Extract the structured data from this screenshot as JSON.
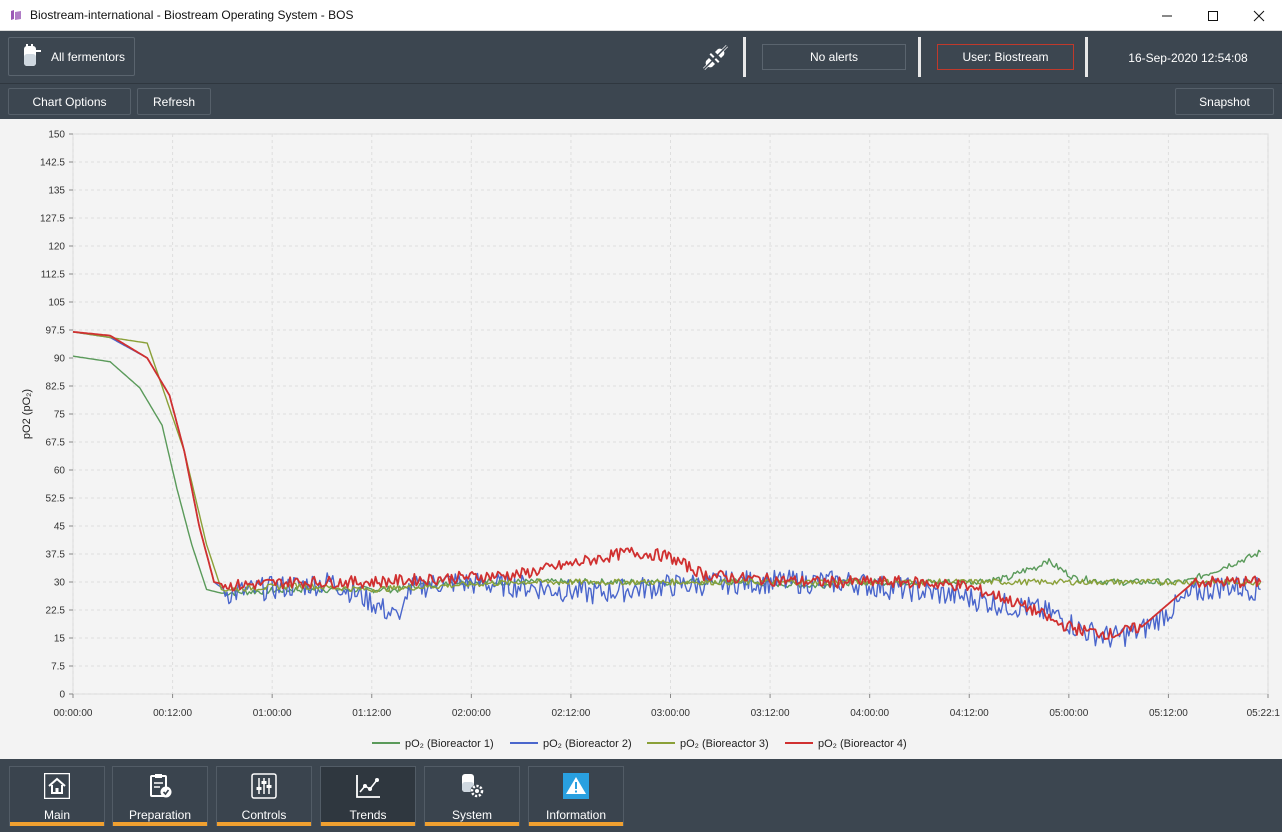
{
  "window": {
    "title": "Biostream-international - Biostream Operating System - BOS"
  },
  "header": {
    "fermentors_label": "All fermentors",
    "alerts_label": "No alerts",
    "user_label": "User: Biostream",
    "datetime": "16-Sep-2020 12:54:08"
  },
  "toolbar": {
    "chart_options_label": "Chart Options",
    "refresh_label": "Refresh",
    "snapshot_label": "Snapshot"
  },
  "chart_data": {
    "type": "line",
    "ylabel": "pO2 (pO₂)",
    "ylim": [
      0,
      150
    ],
    "ytick_step": 7.5,
    "y_ticks": [
      "0",
      "7.5",
      "15",
      "22.5",
      "30",
      "37.5",
      "45",
      "52.5",
      "60",
      "67.5",
      "75",
      "82.5",
      "90",
      "97.5",
      "105",
      "112.5",
      "120",
      "127.5",
      "135",
      "142.5",
      "150"
    ],
    "xlim_minutes": [
      0,
      322
    ],
    "x_ticks": [
      "00:00:00",
      "00:12:00",
      "01:00:00",
      "01:12:00",
      "02:00:00",
      "02:12:00",
      "03:00:00",
      "03:12:00",
      "04:00:00",
      "04:12:00",
      "05:00:00",
      "05:12:00",
      "05:22:1"
    ],
    "grid": true,
    "legend_position": "bottom",
    "series": [
      {
        "name": "pO₂ (Bioreactor 1)",
        "color": "#5a9a5a",
        "x": [
          0,
          10,
          18,
          24,
          28,
          32,
          36,
          40,
          60,
          80,
          88,
          92,
          100,
          120,
          140,
          160,
          180,
          200,
          210,
          215,
          230,
          240,
          252,
          256,
          260,
          262,
          270,
          280,
          285,
          290,
          300,
          310,
          318,
          320
        ],
        "y": [
          90.5,
          89,
          82,
          72,
          55,
          40,
          28,
          27,
          28,
          28,
          28,
          29,
          30,
          30,
          30,
          30,
          30,
          29,
          30,
          30,
          30,
          30,
          31,
          33,
          34,
          36,
          31,
          30,
          30,
          30,
          30,
          34,
          37,
          38
        ]
      },
      {
        "name": "pO₂ (Bioreactor 2)",
        "color": "#4a66cc",
        "x": [
          0,
          10,
          20,
          26,
          30,
          34,
          38,
          42,
          50,
          60,
          70,
          80,
          88,
          90,
          100,
          120,
          140,
          160,
          180,
          200,
          210,
          215,
          225,
          240,
          250,
          258,
          265,
          272,
          280,
          288,
          295,
          302,
          310,
          320
        ],
        "y": [
          97,
          95.5,
          90,
          80,
          65,
          45,
          30,
          27,
          28,
          29,
          30,
          25,
          20,
          28,
          30,
          29,
          27,
          29,
          30,
          30,
          30,
          29,
          28,
          26,
          24,
          23,
          21,
          17,
          15,
          17,
          22,
          27,
          29,
          28
        ]
      },
      {
        "name": "pO₂ (Bioreactor 3)",
        "color": "#8aa038",
        "x": [
          0,
          20,
          30,
          36,
          40,
          60,
          80,
          100,
          120,
          140,
          160,
          180,
          200,
          220,
          240,
          260,
          280,
          300,
          320
        ],
        "y": [
          97,
          94,
          65,
          40,
          28,
          29,
          28,
          29,
          30,
          30,
          30,
          30,
          30,
          30,
          30,
          30,
          30,
          30,
          30
        ]
      },
      {
        "name": "pO₂ (Bioreactor 4)",
        "color": "#d03030",
        "x": [
          0,
          10,
          20,
          26,
          30,
          34,
          38,
          42,
          60,
          80,
          100,
          120,
          140,
          150,
          160,
          170,
          180,
          200,
          210,
          215,
          225,
          240,
          250,
          260,
          265,
          272,
          280,
          288,
          295,
          302,
          310,
          320
        ],
        "y": [
          97,
          96,
          90,
          80,
          65,
          45,
          30,
          29,
          30,
          30,
          31,
          32,
          36,
          38,
          37,
          32,
          31,
          30,
          30,
          30,
          30,
          29,
          26,
          22,
          19,
          17,
          16,
          18,
          24,
          30,
          30,
          30
        ]
      }
    ]
  },
  "nav": {
    "tabs": [
      {
        "label": "Main",
        "icon": "home-icon"
      },
      {
        "label": "Preparation",
        "icon": "clipboard-check-icon"
      },
      {
        "label": "Controls",
        "icon": "sliders-icon"
      },
      {
        "label": "Trends",
        "icon": "trend-chart-icon"
      },
      {
        "label": "System",
        "icon": "system-gear-icon"
      },
      {
        "label": "Information",
        "icon": "warning-icon"
      }
    ],
    "active_tab": "Trends"
  },
  "colors": {
    "header_bg": "#3c4650",
    "accent_orange": "#f0a030",
    "user_border": "#c0392b",
    "info_icon": "#29a0e0"
  }
}
